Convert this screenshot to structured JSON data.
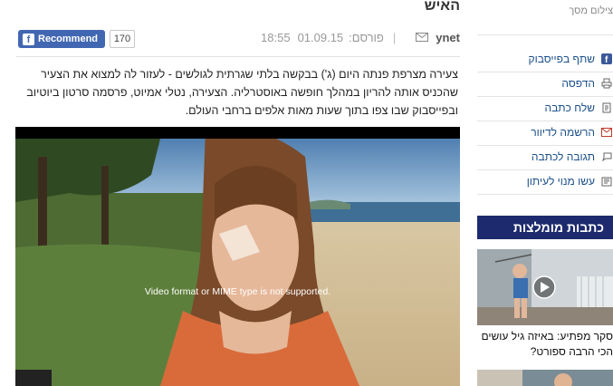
{
  "article": {
    "title": "האיש",
    "title_line1": "",
    "author": "ynet",
    "published_label": "פורסם:",
    "date": "01.09.15",
    "time": "18:55",
    "summary": "צעירה מצרפת פנתה היום (ג') בבקשה בלתי שגרתית לגולשים - לעזור לה למצוא את הצעיר שהכניס אותה להריון במהלך חופשה באוסטרליה. הצעירה, נטלי אמיוט, פרסמה סרטון ביוטיוב ובפייסבוק שבו צפו בתוך שעות מאות אלפים ברחבי העולם.",
    "video_message": "Video format or MIME type is not supported.",
    "facebook": {
      "label": "Recommend",
      "count": "170"
    }
  },
  "sidebar": {
    "photo_credit": "צילום מסך",
    "share_items": [
      {
        "label": "שתף בפייסבוק",
        "icon": "facebook-icon"
      },
      {
        "label": "הדפסה",
        "icon": "print-icon"
      },
      {
        "label": "שלח כתבה",
        "icon": "send-icon"
      },
      {
        "label": "הרשמה לדיוור",
        "icon": "mail-icon"
      },
      {
        "label": "תגובה לכתבה",
        "icon": "comment-icon"
      },
      {
        "label": "עשו מנוי לעיתון",
        "icon": "newspaper-icon"
      }
    ],
    "recommended_title": "כתבות מומלצות",
    "recommended": [
      {
        "caption": "סקר מפתיע: באיזה גיל עושים הכי הרבה ספורט?"
      }
    ]
  },
  "colors": {
    "facebook": "#4267b2",
    "link": "#1a4f8a",
    "section_header": "#1e2a6e"
  }
}
